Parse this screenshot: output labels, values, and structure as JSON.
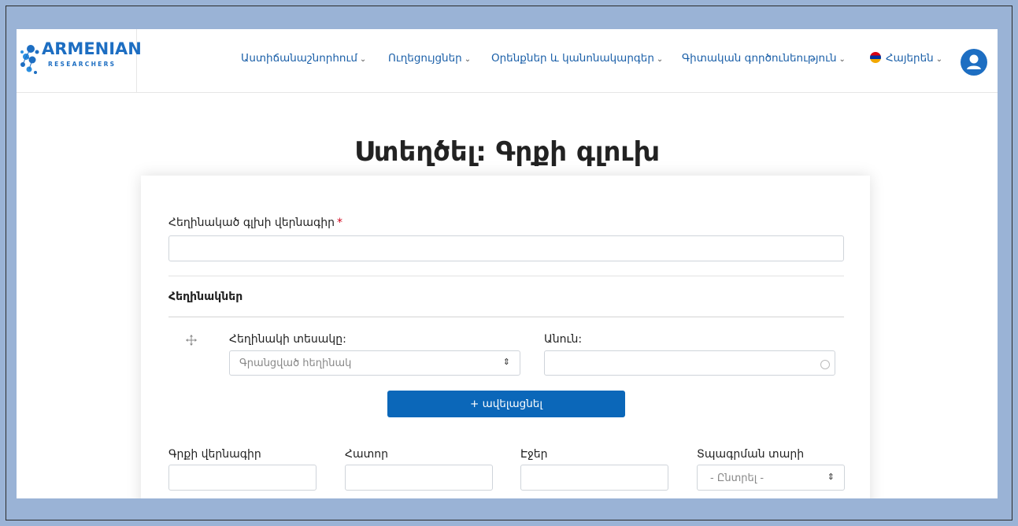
{
  "logo": {
    "main": "ARMENIAN",
    "sub": "RESEARCHERS"
  },
  "nav": {
    "items": [
      {
        "label": "Աստիճանաշնորհում"
      },
      {
        "label": "Ուղեցույցներ"
      },
      {
        "label": "Օրենքներ և կանոնակարգեր"
      },
      {
        "label": "Գիտական գործունեություն"
      }
    ],
    "language": "Հայերեն",
    "caret": "⌄"
  },
  "page": {
    "title": "Ստեղծել: Գրքի գլուխ"
  },
  "form": {
    "chapter_title_label": "Հեղինակած գլխի վերնագիր",
    "required_mark": "*",
    "chapter_title_value": "",
    "authors_section": "Հեղինակներ",
    "author_type_label": "Հեղինակի տեսակը:",
    "author_type_value": "Գրանցված հեղինակ",
    "name_label": "Անուն:",
    "name_value": "",
    "add_button": "+ ավելացնել",
    "book_title_label": "Գրքի վերնագիր",
    "volume_label": "Հատոր",
    "pages_label": "Էջեր",
    "pub_year_label": "Տպագրման տարի",
    "pub_year_value": "- Ընտրել -"
  },
  "colors": {
    "primary": "#0b67b9",
    "nav_text": "#1a5fa8",
    "required": "#d0021b",
    "background": "#9ab3d6"
  }
}
